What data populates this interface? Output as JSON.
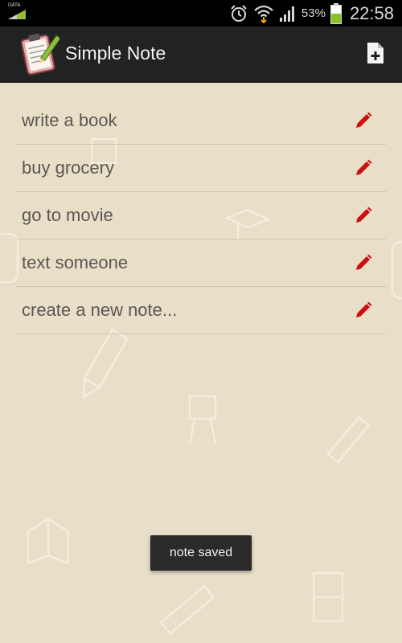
{
  "status_bar": {
    "data_label": "DATA",
    "battery_percent": "53%",
    "battery_level": 0.53,
    "time": "22:58",
    "icons": [
      "alarm-icon",
      "wifi-icon",
      "signal-icon",
      "battery-icon"
    ]
  },
  "action_bar": {
    "title": "Simple Note",
    "app_icon": "clipboard-note-icon",
    "new_note_icon": "new-note-icon"
  },
  "notes": {
    "items": [
      {
        "label": "write a book"
      },
      {
        "label": "buy grocery"
      },
      {
        "label": "go to movie"
      },
      {
        "label": "text someone"
      },
      {
        "label": "create a new note..."
      }
    ],
    "edit_icon": "pencil-icon",
    "edit_color": "#cc1010"
  },
  "toast": {
    "message": "note saved"
  },
  "colors": {
    "background": "#e9dfc8",
    "action_bar": "#222222",
    "status_bar": "#000000",
    "battery_fill": "#8bc21f"
  }
}
